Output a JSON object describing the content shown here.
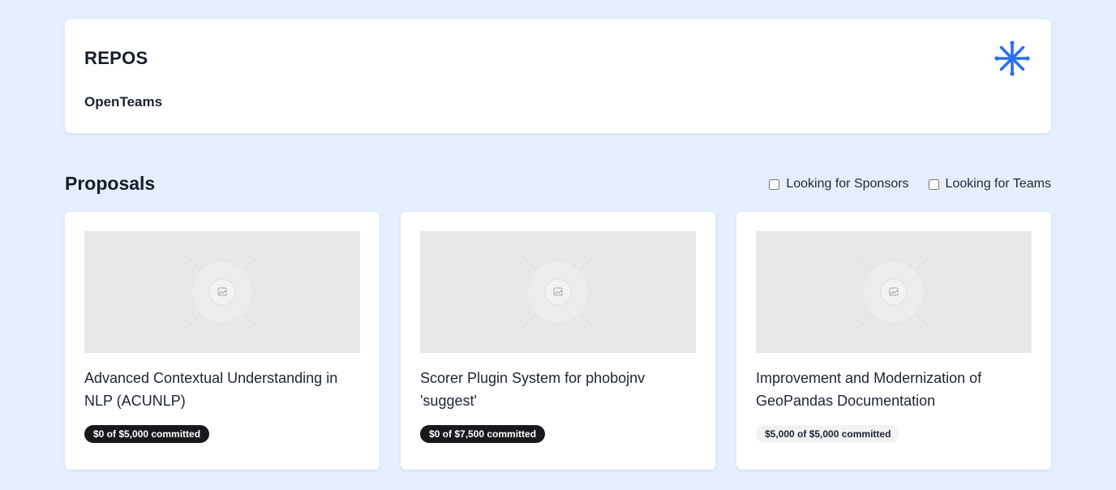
{
  "header": {
    "title": "REPOS",
    "org_name": "OpenTeams",
    "logo_icon": "snowflake-icon",
    "accent_color": "#2a6ef0"
  },
  "proposals": {
    "title": "Proposals",
    "filters": [
      {
        "label": "Looking for Sponsors",
        "checked": false
      },
      {
        "label": "Looking for Teams",
        "checked": false
      }
    ],
    "cards": [
      {
        "image_icon": "image-placeholder-icon",
        "title": "Advanced Contextual Understanding in NLP (ACUNLP)",
        "badge": "$0 of $5,000 committed",
        "badge_style": "dark"
      },
      {
        "image_icon": "image-placeholder-icon",
        "title": "Scorer Plugin System for phobojnv 'suggest'",
        "badge": "$0 of $7,500 committed",
        "badge_style": "dark"
      },
      {
        "image_icon": "image-placeholder-icon",
        "title": "Improvement and Modernization of GeoPandas Documentation",
        "badge": "$5,000 of $5,000 committed",
        "badge_style": "light"
      }
    ]
  }
}
